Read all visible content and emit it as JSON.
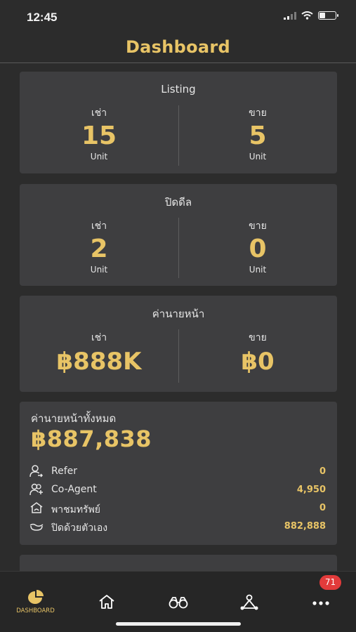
{
  "status_bar": {
    "time": "12:45"
  },
  "header": {
    "title": "Dashboard"
  },
  "listing": {
    "title": "Listing",
    "rent": {
      "label": "เช่า",
      "value": "15",
      "unit": "Unit"
    },
    "sale": {
      "label": "ขาย",
      "value": "5",
      "unit": "Unit"
    }
  },
  "closed_deals": {
    "title": "ปิดดีล",
    "rent": {
      "label": "เช่า",
      "value": "2",
      "unit": "Unit"
    },
    "sale": {
      "label": "ขาย",
      "value": "0",
      "unit": "Unit"
    }
  },
  "commission": {
    "title": "ค่านายหน้า",
    "rent": {
      "label": "เช่า",
      "value": "฿888K"
    },
    "sale": {
      "label": "ขาย",
      "value": "฿0"
    }
  },
  "total_commission": {
    "label": "ค่านายหน้าทั้งหมด",
    "value": "฿887,838",
    "rows": [
      {
        "icon": "refer-icon",
        "label": "Refer",
        "value": "0"
      },
      {
        "icon": "co-agent-icon",
        "label": "Co-Agent",
        "value": "4,950"
      },
      {
        "icon": "property-icon",
        "label": "พาชมทรัพย์",
        "value": "0"
      },
      {
        "icon": "self-close-icon",
        "label": "ปิดด้วยตัวเอง",
        "value": "882,888"
      }
    ]
  },
  "bottom_nav": {
    "items": [
      {
        "icon": "pie-chart-icon",
        "label": "DASHBOARD",
        "active": true
      },
      {
        "icon": "home-icon",
        "label": ""
      },
      {
        "icon": "binoculars-icon",
        "label": ""
      },
      {
        "icon": "network-icon",
        "label": ""
      },
      {
        "icon": "more-icon",
        "label": ""
      }
    ],
    "badge": "71"
  },
  "colors": {
    "accent": "#e8c466",
    "card": "#3e3e40",
    "background": "#2c2c2c",
    "badge": "#e23b3b"
  }
}
